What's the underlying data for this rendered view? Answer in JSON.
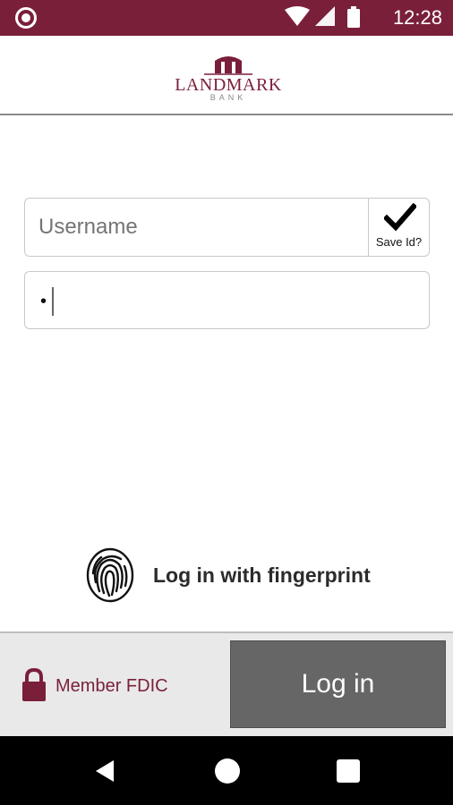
{
  "status_bar": {
    "time": "12:28",
    "icons": [
      "record-icon",
      "wifi-icon",
      "signal-icon",
      "battery-icon"
    ]
  },
  "header": {
    "logo_text": "LANDMARK",
    "logo_subtext": "BANK"
  },
  "login_form": {
    "username_placeholder": "Username",
    "save_id_label": "Save Id?",
    "save_id_checked": true,
    "password_masked": "•"
  },
  "fingerprint": {
    "label": "Log in with fingerprint"
  },
  "footer": {
    "member_label": "Member FDIC",
    "login_button_label": "Log in"
  },
  "colors": {
    "brand": "#7a1f3a",
    "button": "#666666",
    "footer_bg": "#e9e9e9"
  }
}
